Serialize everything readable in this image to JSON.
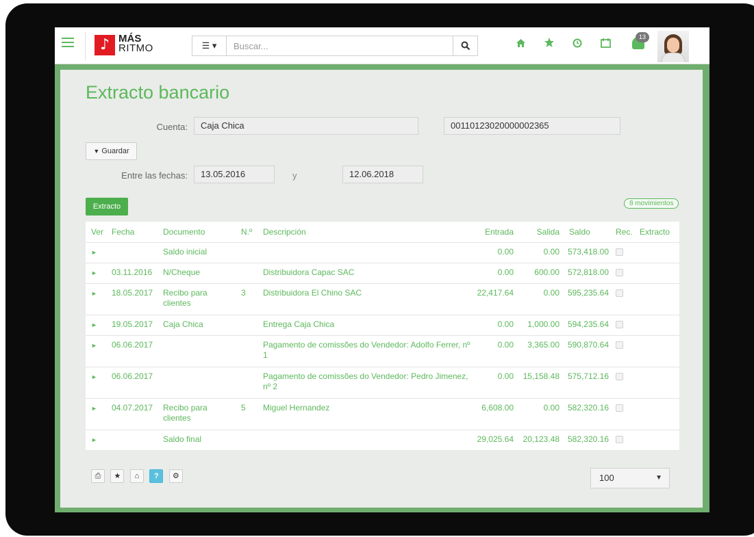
{
  "app": {
    "logo_line1": "MÁS",
    "logo_line2": "RITMO",
    "logo_glyph": "♪"
  },
  "search": {
    "list_icon": "☰ ▾",
    "placeholder": "Buscar...",
    "search_icon": "search-icon"
  },
  "nav_icons": [
    "home-icon",
    "star-icon",
    "clock-icon",
    "calendar-icon",
    "bell-icon"
  ],
  "notifications": {
    "count": "13"
  },
  "page": {
    "title": "Extracto bancario"
  },
  "form": {
    "cuenta_label": "Cuenta:",
    "cuenta_value": "Caja Chica",
    "account_number": "00110123020000002365",
    "guardar_label": "Guardar",
    "fechas_label": "Entre las fechas:",
    "date_from": "13.05.2016",
    "y_label": "y",
    "date_to": "12.06.2018"
  },
  "actions": {
    "extracto_label": "Extracto",
    "movimientos_badge": "8 movimientos"
  },
  "table": {
    "headers": {
      "ver": "Ver",
      "fecha": "Fecha",
      "documento": "Documento",
      "numero": "N.º",
      "descripcion": "Descripción",
      "entrada": "Entrada",
      "salida": "Salida",
      "saldo": "Saldo",
      "rec": "Rec.",
      "extracto": "Extracto"
    },
    "rows": [
      {
        "fecha": "",
        "documento": "Saldo inicial",
        "numero": "",
        "descripcion": "",
        "entrada": "0.00",
        "salida": "0.00",
        "saldo": "573,418.00"
      },
      {
        "fecha": "03.11.2016",
        "documento": "N/Cheque",
        "numero": "",
        "descripcion": "Distribuidora Capac SAC",
        "entrada": "0.00",
        "salida": "600.00",
        "saldo": "572,818.00"
      },
      {
        "fecha": "18.05.2017",
        "documento": "Recibo para clientes",
        "numero": "3",
        "descripcion": "Distribuidora El Chino SAC",
        "entrada": "22,417.64",
        "salida": "0.00",
        "saldo": "595,235.64"
      },
      {
        "fecha": "19.05.2017",
        "documento": "Caja Chica",
        "numero": "",
        "descripcion": "Entrega Caja Chica",
        "entrada": "0.00",
        "salida": "1,000.00",
        "saldo": "594,235.64"
      },
      {
        "fecha": "06.06.2017",
        "documento": "",
        "numero": "",
        "descripcion": "Pagamento de comissões do Vendedor: Adolfo Ferrer, nº 1",
        "entrada": "0.00",
        "salida": "3,365.00",
        "saldo": "590,870.64"
      },
      {
        "fecha": "06.06.2017",
        "documento": "",
        "numero": "",
        "descripcion": "Pagamento de comissões do Vendedor: Pedro Jimenez, nº 2",
        "entrada": "0.00",
        "salida": "15,158.48",
        "saldo": "575,712.16"
      },
      {
        "fecha": "04.07.2017",
        "documento": "Recibo para clientes",
        "numero": "5",
        "descripcion": "Miguel Hernandez",
        "entrada": "6,608.00",
        "salida": "0.00",
        "saldo": "582,320.16"
      },
      {
        "fecha": "",
        "documento": "Saldo final",
        "numero": "",
        "descripcion": "",
        "entrada": "29,025.64",
        "salida": "20,123.48",
        "saldo": "582,320.16"
      }
    ]
  },
  "footer": {
    "tools": [
      "print-icon",
      "star-icon",
      "home-add-icon",
      "help-icon",
      "gear-icon"
    ],
    "page_size": "100"
  },
  "colors": {
    "accent": "#5cb85c",
    "frame": "#6fae6f",
    "logo": "#e21b23"
  }
}
